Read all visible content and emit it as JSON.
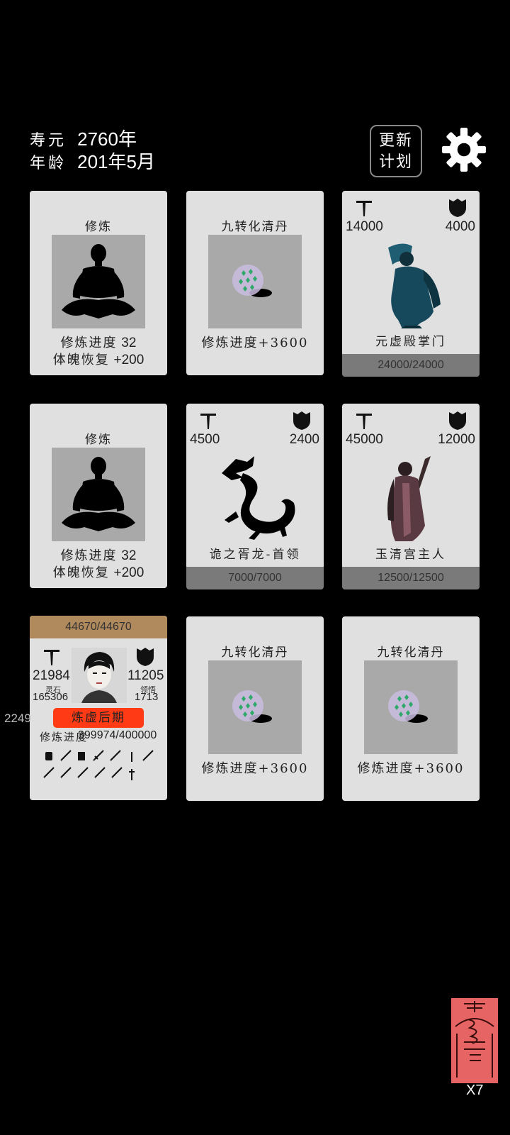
{
  "status": {
    "lifespan_label": "寿元",
    "lifespan_value": "2760年",
    "age_label": "年龄",
    "age_value": "201年5月"
  },
  "plan_button": {
    "line1": "更新",
    "line2": "计划"
  },
  "cards": {
    "c1": {
      "title": "修炼",
      "progress_label": "修炼进度",
      "progress_value": "32",
      "recover_label": "体魄恢复",
      "recover_value": "+200",
      "icon": "meditating-figure-icon"
    },
    "c2": {
      "title": "九转化清丹",
      "line": "修炼进度+3600",
      "icon": "pill-icon"
    },
    "c3": {
      "atk": "14000",
      "def": "4000",
      "name": "元虚殿掌门",
      "hp": "24000/24000",
      "icon": "sect-master-portrait"
    },
    "c4": {
      "title": "修炼",
      "progress_label": "修炼进度",
      "progress_value": "32",
      "recover_label": "体魄恢复",
      "recover_value": "+200",
      "icon": "meditating-figure-icon"
    },
    "c5": {
      "atk": "4500",
      "def": "2400",
      "name": "诡之胥龙-首领",
      "hp": "7000/7000",
      "icon": "dragon-silhouette-icon"
    },
    "c6": {
      "atk": "45000",
      "def": "12000",
      "name": "玉清宫主人",
      "hp": "12500/12500",
      "icon": "palace-master-portrait"
    },
    "player": {
      "hp": "44670/44670",
      "atk": "21984",
      "def": "11205",
      "spirit_stone_label": "灵石",
      "spirit_stone": "165306",
      "insight_label": "领悟",
      "insight": "1713",
      "side_value": "2249",
      "realm": "炼虚后期",
      "progress_label": "修炼进度",
      "progress_value": "399974/400000"
    },
    "c8": {
      "title": "九转化清丹",
      "line": "修炼进度+3600",
      "icon": "pill-icon"
    },
    "c9": {
      "title": "九转化清丹",
      "line": "修炼进度+3600",
      "icon": "pill-icon"
    }
  },
  "talisman": {
    "count": "X7"
  },
  "colors": {
    "card_bg": "#e0e0e0",
    "hp_bar": "#7a7a7a",
    "player_hp": "#b08a5c",
    "realm_badge": "#ff3a14",
    "talisman": "#e76464"
  }
}
